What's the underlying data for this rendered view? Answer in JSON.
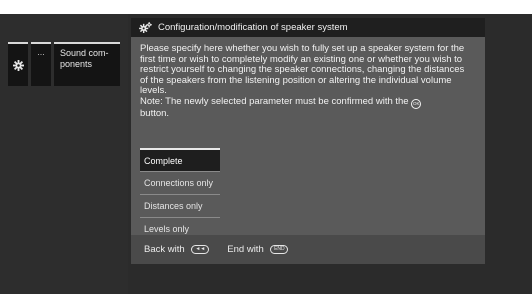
{
  "nav": {
    "gear_icon": "gear-icon",
    "dots": "…",
    "label": "Sound com-\nponents"
  },
  "dialog": {
    "title": "Configuration/modification of speaker system",
    "description_main": "Please specify here whether you wish to fully set up a speaker system for the first time or wish to completely modify an existing one or whether you wish to restrict yourself to changing the speaker connections, changing the distances of the speakers from the listening position or altering the individual volume levels.",
    "note_before": "Note: The newly selected parameter must be confirmed with the",
    "note_after": "button.",
    "ok_button_icon": "OK",
    "options": [
      {
        "label": "Complete",
        "selected": true
      },
      {
        "label": "Connections only",
        "selected": false
      },
      {
        "label": "Distances only",
        "selected": false
      },
      {
        "label": "Levels only",
        "selected": false
      }
    ],
    "footer": {
      "back_label": "Back with",
      "back_icon": "◄◄",
      "end_label": "End with",
      "end_icon": "END"
    }
  }
}
